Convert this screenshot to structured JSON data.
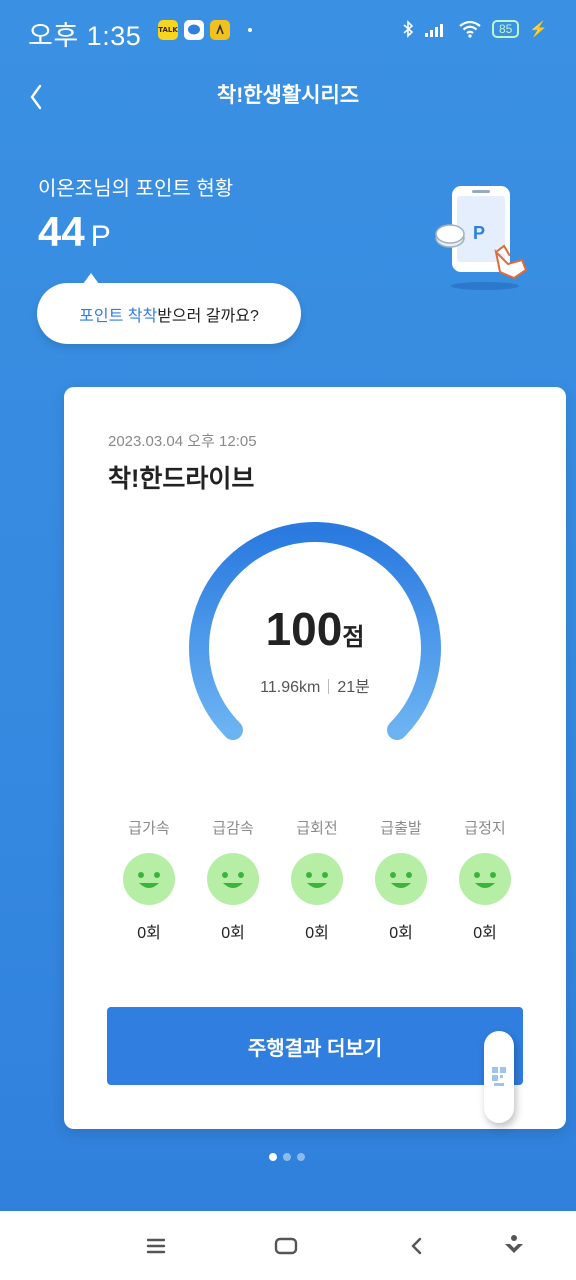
{
  "status_bar": {
    "time": "오후 1:35",
    "battery": "85",
    "app_icons": [
      "kakaotalk-icon",
      "message-icon",
      "app-icon"
    ]
  },
  "header": {
    "title": "착!한생활시리즈",
    "back_icon": "chevron-left-icon"
  },
  "points": {
    "label": "이온조님의 포인트 현황",
    "value": "44",
    "unit": "P"
  },
  "bubble": {
    "highlight": "포인트 착착",
    "text": " 받으러 갈까요?"
  },
  "card": {
    "date": "2023.03.04 오후 12:05",
    "title": "착!한드라이브",
    "score": "100",
    "score_unit": "점",
    "score_value": 100,
    "distance": "11.96km",
    "duration": "21분",
    "events": [
      {
        "label": "급가속",
        "count": "0회"
      },
      {
        "label": "급감속",
        "count": "0회"
      },
      {
        "label": "급회전",
        "count": "0회"
      },
      {
        "label": "급출발",
        "count": "0회"
      },
      {
        "label": "급정지",
        "count": "0회"
      }
    ],
    "button_label": "주행결과 더보기"
  },
  "pager": {
    "count": 3,
    "active": 0
  },
  "colors": {
    "primary": "#2f7ee0",
    "background": "#3589e0",
    "face_green": "#b7eea5",
    "face_features": "#3cb43c"
  }
}
